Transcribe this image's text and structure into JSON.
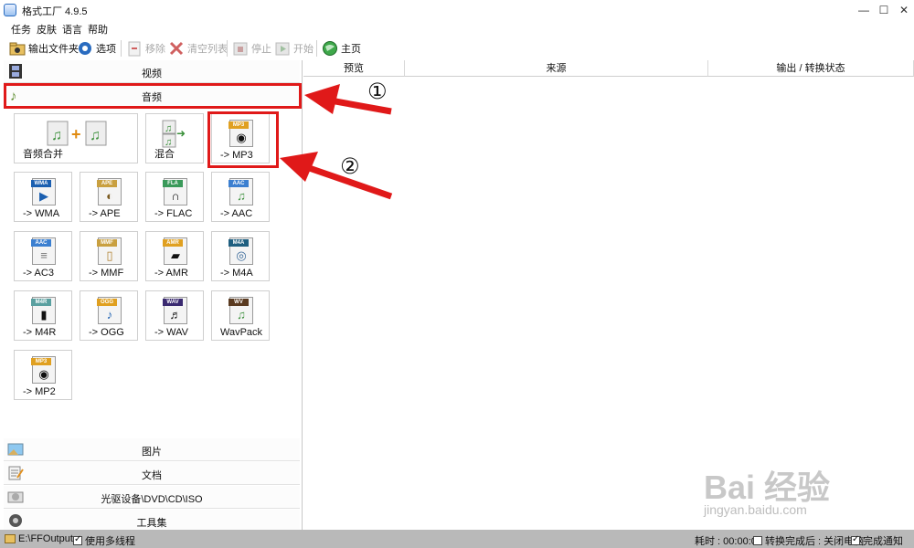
{
  "app": {
    "title": "格式工厂 4.9.5"
  },
  "window_controls": {
    "minimize": "—",
    "maximize": "☐",
    "close": "✕"
  },
  "menu": {
    "items": [
      "任务",
      "皮肤",
      "语言",
      "帮助"
    ]
  },
  "toolbar": {
    "output_folder": "输出文件夹",
    "options": "选项",
    "remove": "移除",
    "clear_list": "清空列表",
    "stop": "停止",
    "start": "开始",
    "home": "主页"
  },
  "categories": {
    "video": "视频",
    "audio": "音频",
    "image": "图片",
    "document": "文档",
    "disc": "光驱设备\\DVD\\CD\\ISO",
    "tools": "工具集"
  },
  "audio_tiles": [
    {
      "label": "音频合并",
      "badge": "",
      "badge_color": "#3a8f3a"
    },
    {
      "label": "混合",
      "badge": "",
      "badge_color": "#3a8f3a"
    },
    {
      "label": "-> MP3",
      "badge": "MP3",
      "badge_color": "#e0a020"
    },
    {
      "label": "-> WMA",
      "badge": "WMA",
      "badge_color": "#1b5fb0"
    },
    {
      "label": "-> APE",
      "badge": "APE",
      "badge_color": "#c9a040"
    },
    {
      "label": "-> FLAC",
      "badge": "FLA",
      "badge_color": "#3a9a5a"
    },
    {
      "label": "-> AAC",
      "badge": "AAC",
      "badge_color": "#3b7fd0"
    },
    {
      "label": "-> AC3",
      "badge": "AAC",
      "badge_color": "#3b7fd0"
    },
    {
      "label": "-> MMF",
      "badge": "MMF",
      "badge_color": "#c9a040"
    },
    {
      "label": "-> AMR",
      "badge": "AMR",
      "badge_color": "#e0a020"
    },
    {
      "label": "-> M4A",
      "badge": "M4A",
      "badge_color": "#1f5f80"
    },
    {
      "label": "-> M4R",
      "badge": "M4R",
      "badge_color": "#5aa0a0"
    },
    {
      "label": "-> OGG",
      "badge": "OGG",
      "badge_color": "#e0a020"
    },
    {
      "label": "-> WAV",
      "badge": "WAV",
      "badge_color": "#3a2a70"
    },
    {
      "label": "WavPack",
      "badge": "WV",
      "badge_color": "#5a3a20"
    },
    {
      "label": "-> MP2",
      "badge": "MP3",
      "badge_color": "#e0a020"
    }
  ],
  "table": {
    "columns": [
      "预览",
      "来源",
      "输出 / 转换状态"
    ]
  },
  "annotations": {
    "one": "①",
    "two": "②"
  },
  "status": {
    "output_path": "E:\\FFOutput",
    "multithread": "使用多线程",
    "elapsed": "耗时 : 00:00:00",
    "after_convert": "转换完成后 : 关闭电脑",
    "notify": "完成通知"
  },
  "watermark": {
    "main": "Bai 经验",
    "sub": "jingyan.baidu.com"
  },
  "colors": {
    "annotation_red": "#e01919",
    "statusbar": "#b9b9b9"
  }
}
